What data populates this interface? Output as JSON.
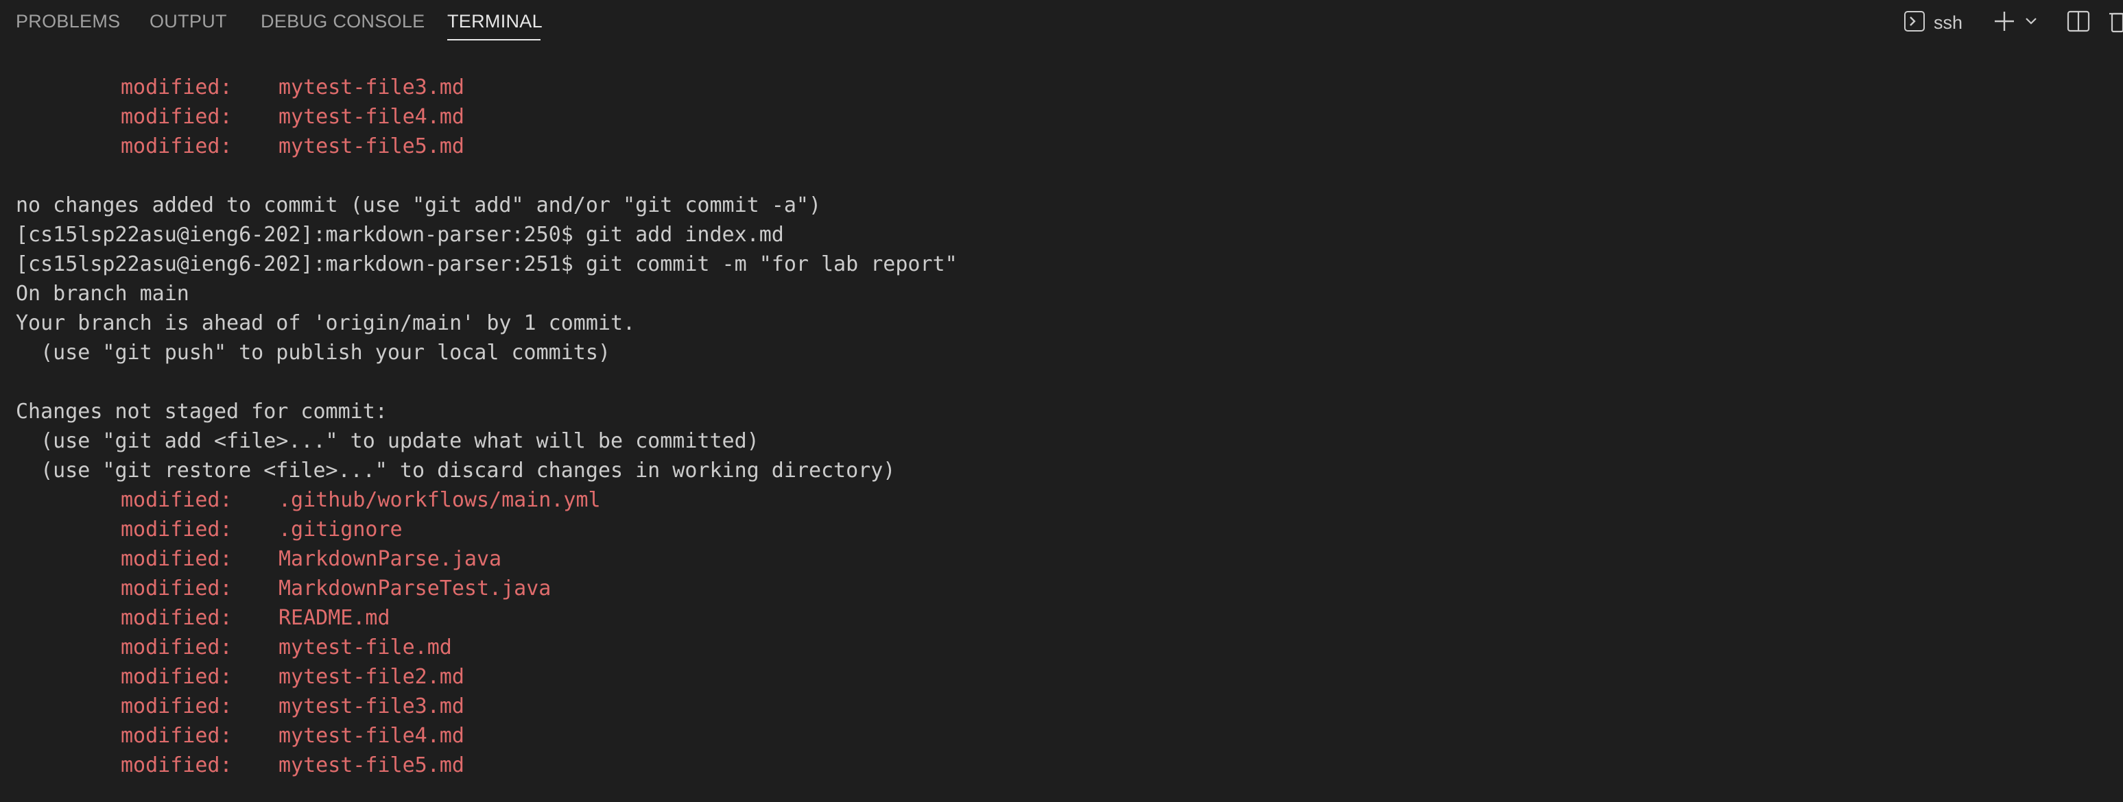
{
  "panel": {
    "tabs": [
      {
        "label": "PROBLEMS",
        "active": false
      },
      {
        "label": "OUTPUT",
        "active": false
      },
      {
        "label": "DEBUG CONSOLE",
        "active": false
      },
      {
        "label": "TERMINAL",
        "active": true
      }
    ],
    "terminal_name": "ssh",
    "icons": {
      "terminal": "terminal-icon",
      "add": "plus-icon",
      "dropdown": "chevron-down-icon",
      "split": "split-terminal-icon",
      "trash": "trash-icon"
    }
  },
  "terminal": {
    "lines": [
      {
        "type": "modified",
        "label": "modified:",
        "file": "mytest-file3.md"
      },
      {
        "type": "modified",
        "label": "modified:",
        "file": "mytest-file4.md"
      },
      {
        "type": "modified",
        "label": "modified:",
        "file": "mytest-file5.md"
      },
      {
        "type": "plain",
        "text": ""
      },
      {
        "type": "plain",
        "text": "no changes added to commit (use \"git add\" and/or \"git commit -a\")"
      },
      {
        "type": "plain",
        "text": "[cs15lsp22asu@ieng6-202]:markdown-parser:250$ git add index.md"
      },
      {
        "type": "plain",
        "text": "[cs15lsp22asu@ieng6-202]:markdown-parser:251$ git commit -m \"for lab report\""
      },
      {
        "type": "plain",
        "text": "On branch main"
      },
      {
        "type": "plain",
        "text": "Your branch is ahead of 'origin/main' by 1 commit."
      },
      {
        "type": "plain",
        "text": "  (use \"git push\" to publish your local commits)"
      },
      {
        "type": "plain",
        "text": ""
      },
      {
        "type": "plain",
        "text": "Changes not staged for commit:"
      },
      {
        "type": "plain",
        "text": "  (use \"git add <file>...\" to update what will be committed)"
      },
      {
        "type": "plain",
        "text": "  (use \"git restore <file>...\" to discard changes in working directory)"
      },
      {
        "type": "modified",
        "label": "modified:",
        "file": ".github/workflows/main.yml"
      },
      {
        "type": "modified",
        "label": "modified:",
        "file": ".gitignore"
      },
      {
        "type": "modified",
        "label": "modified:",
        "file": "MarkdownParse.java"
      },
      {
        "type": "modified",
        "label": "modified:",
        "file": "MarkdownParseTest.java"
      },
      {
        "type": "modified",
        "label": "modified:",
        "file": "README.md"
      },
      {
        "type": "modified",
        "label": "modified:",
        "file": "mytest-file.md"
      },
      {
        "type": "modified",
        "label": "modified:",
        "file": "mytest-file2.md"
      },
      {
        "type": "modified",
        "label": "modified:",
        "file": "mytest-file3.md"
      },
      {
        "type": "modified",
        "label": "modified:",
        "file": "mytest-file4.md"
      },
      {
        "type": "modified",
        "label": "modified:",
        "file": "mytest-file5.md"
      }
    ]
  },
  "colors": {
    "background": "#1e1e1e",
    "text": "#cccccc",
    "modified": "#e06c6c",
    "tab_active": "#e7e7e7",
    "tab_inactive": "#a0a0a0"
  }
}
